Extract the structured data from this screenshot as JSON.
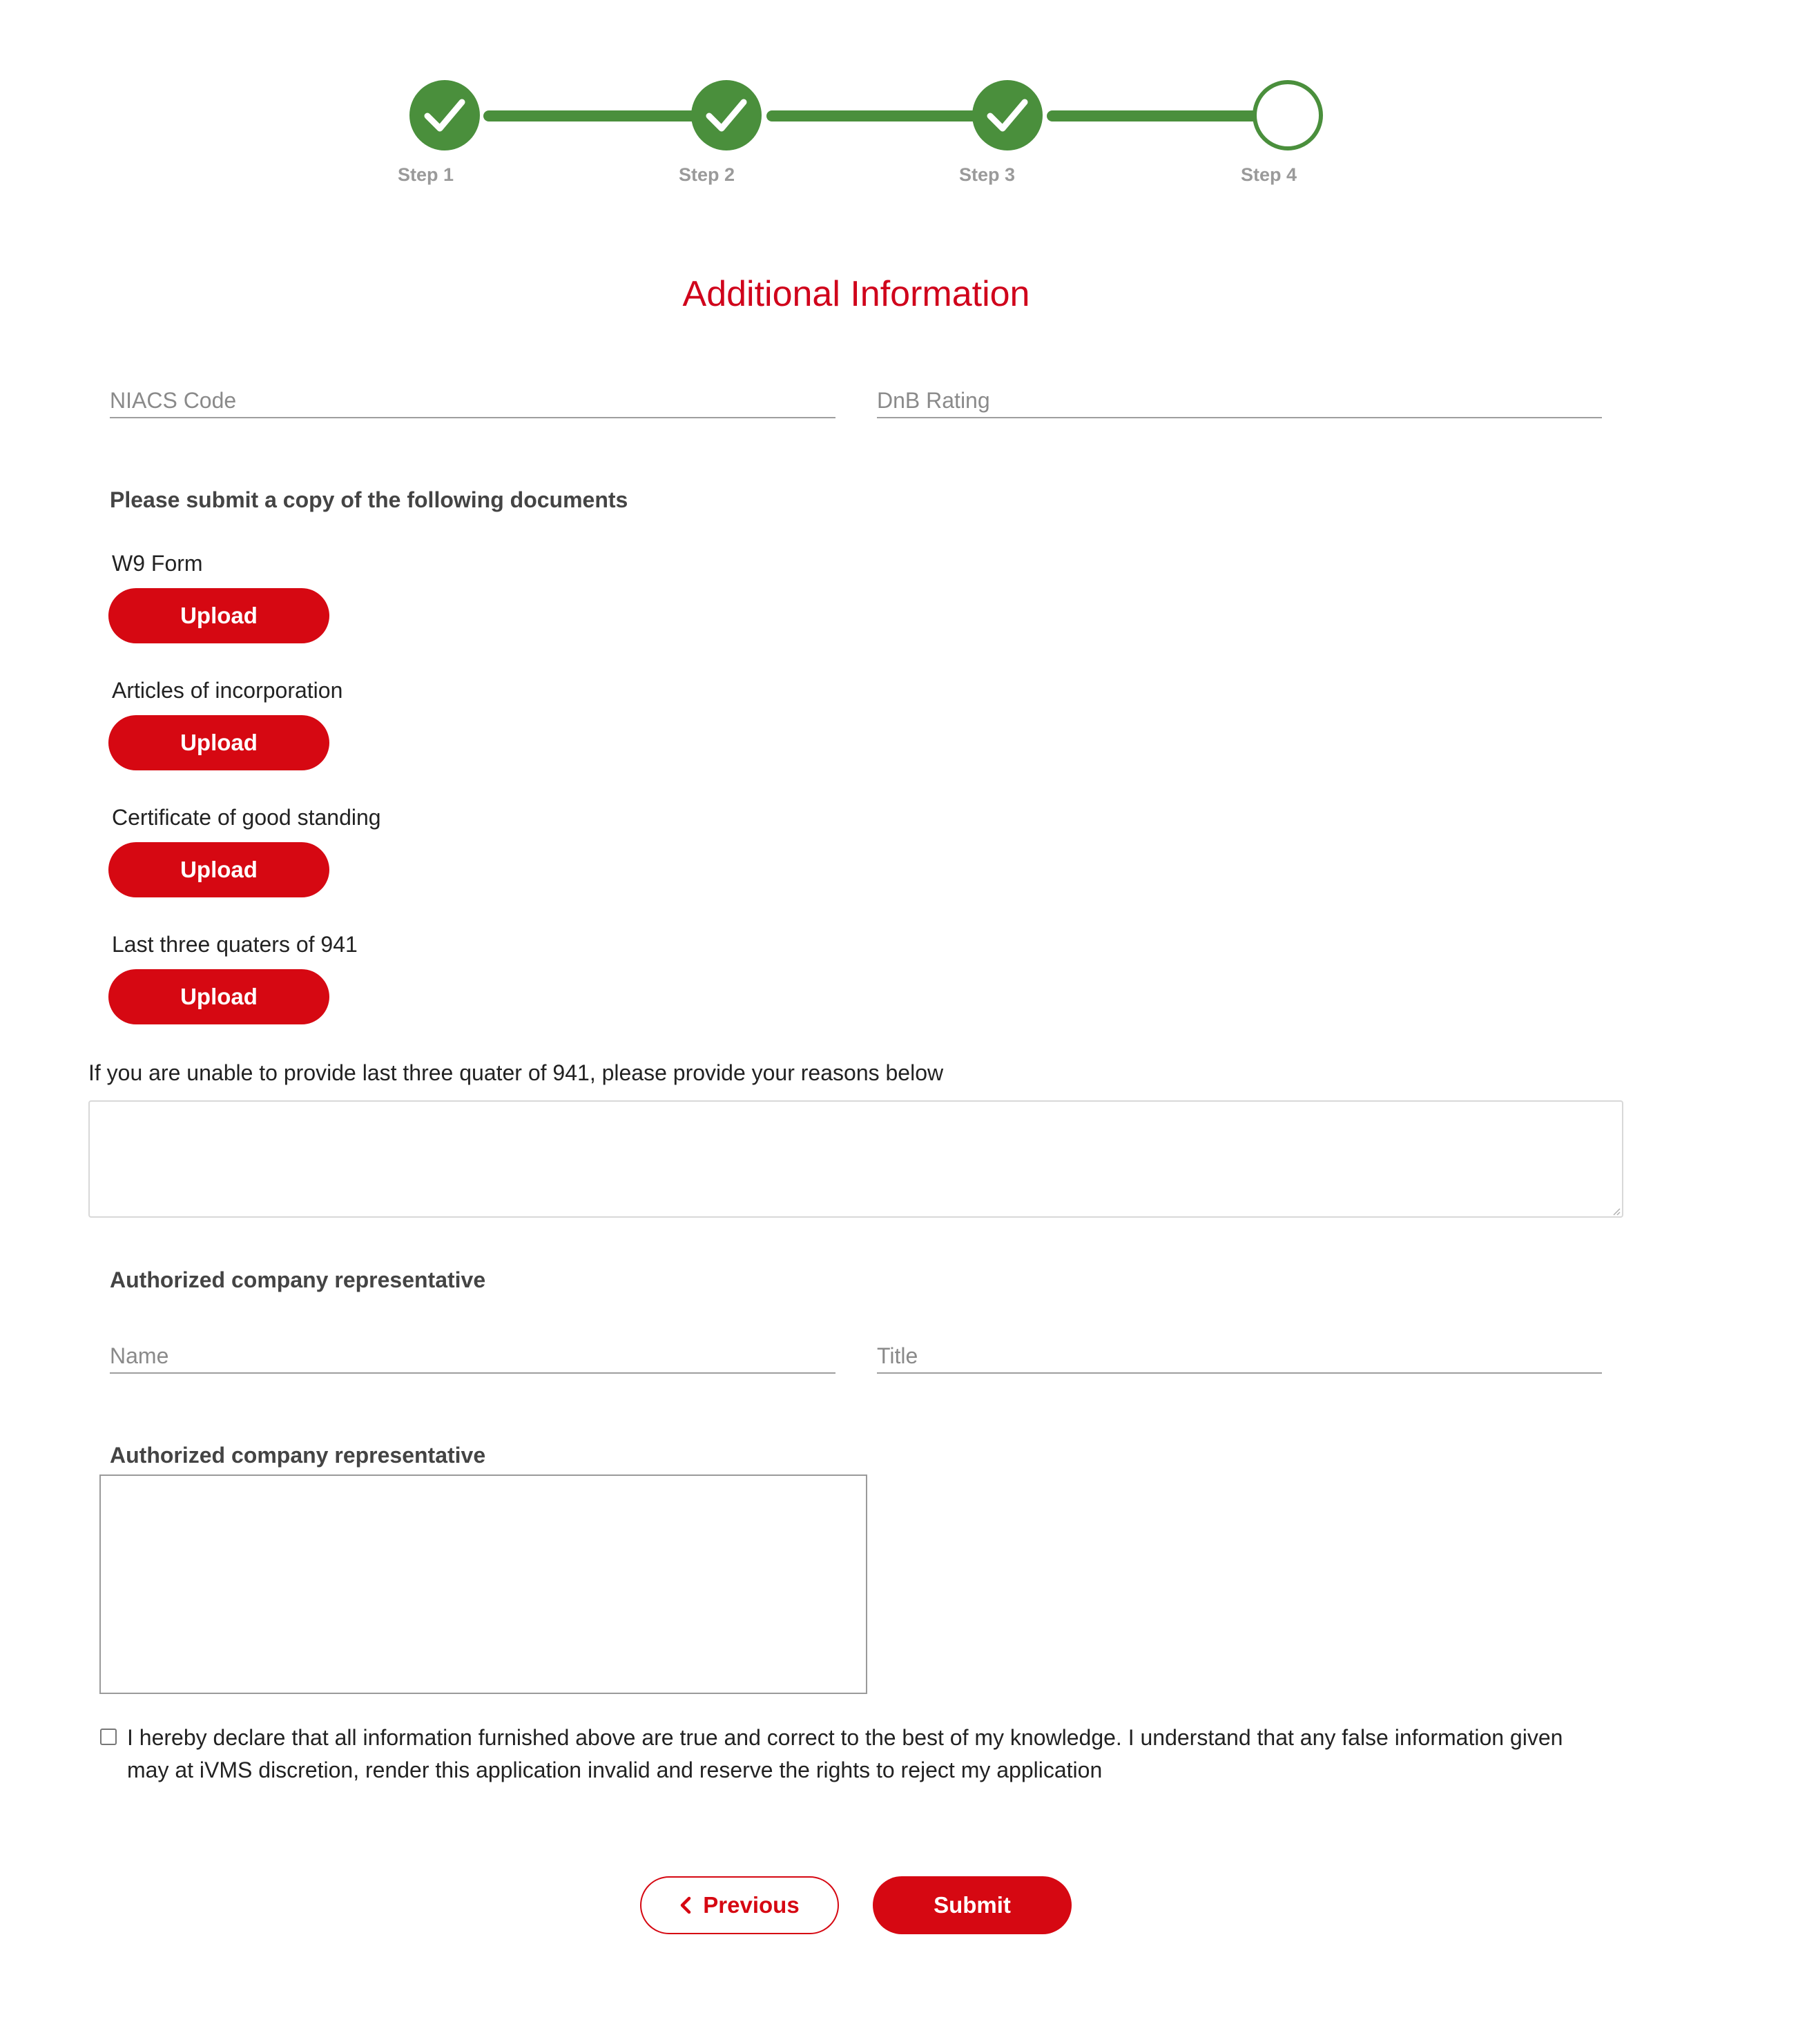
{
  "stepper": {
    "steps": [
      {
        "label": "Step 1",
        "state": "done"
      },
      {
        "label": "Step 2",
        "state": "done"
      },
      {
        "label": "Step 3",
        "state": "done"
      },
      {
        "label": "Step 4",
        "state": "current"
      }
    ],
    "color": "#4a8f3c"
  },
  "page_title": "Additional Information",
  "company_fields": {
    "niacs_placeholder": "NIACS Code",
    "dnb_placeholder": "DnB Rating"
  },
  "documents": {
    "heading": "Please submit a copy of the following documents",
    "items": [
      {
        "label": "W9 Form",
        "button": "Upload"
      },
      {
        "label": "Articles of incorporation",
        "button": "Upload"
      },
      {
        "label": "Certificate of good standing",
        "button": "Upload"
      },
      {
        "label": "Last three quaters of 941",
        "button": "Upload"
      }
    ]
  },
  "reason": {
    "label": "If you are unable to provide last three quater of 941, please provide your reasons below",
    "value": ""
  },
  "representative": {
    "heading": "Authorized company representative",
    "name_placeholder": "Name",
    "title_placeholder": "Title"
  },
  "signature": {
    "heading": "Authorized company representative"
  },
  "declaration": {
    "checked": false,
    "text": "I hereby declare that all information furnished above are true and correct to the best of my knowledge. I understand that any false information given may at iVMS discretion, render this application invalid and reserve the rights to reject my application"
  },
  "actions": {
    "previous_label": "Previous",
    "submit_label": "Submit"
  },
  "colors": {
    "accent": "#d60812",
    "title": "#d0021b",
    "success": "#4a8f3c"
  }
}
